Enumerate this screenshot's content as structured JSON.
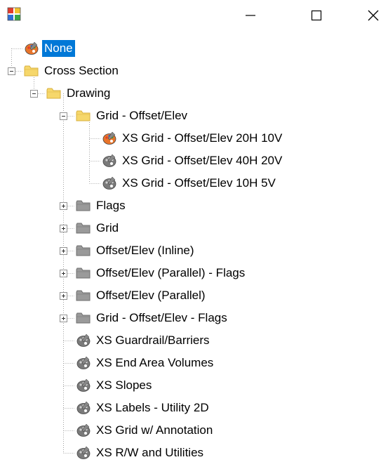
{
  "window": {
    "controls": {
      "minimize": "minimize-icon",
      "maximize": "maximize-icon",
      "close": "close-icon"
    }
  },
  "colors": {
    "selection": "#0078d7",
    "folder_open": "#f6d76b",
    "folder_closed": "#9a9a9a",
    "palette_active": "#e8742a",
    "palette_inactive": "#7a7a7a"
  },
  "tree": {
    "nodes": [
      {
        "label": "None",
        "selected": true,
        "icon": "palette-color-icon",
        "expander": null
      },
      {
        "label": "Cross Section",
        "icon": "folder-open-icon",
        "expander": "collapse"
      },
      {
        "label": "Drawing",
        "icon": "folder-open-icon",
        "expander": "collapse"
      },
      {
        "label": "Grid - Offset/Elev",
        "icon": "folder-open-icon",
        "expander": "collapse"
      },
      {
        "label": "XS Grid - Offset/Elev 20H 10V",
        "icon": "palette-color-icon",
        "expander": null
      },
      {
        "label": "XS Grid - Offset/Elev 40H 20V",
        "icon": "palette-gray-icon",
        "expander": null
      },
      {
        "label": "XS Grid - Offset/Elev 10H 5V",
        "icon": "palette-gray-icon",
        "expander": null
      },
      {
        "label": "Flags",
        "icon": "folder-closed-icon",
        "expander": "expand"
      },
      {
        "label": "Grid",
        "icon": "folder-closed-icon",
        "expander": "expand"
      },
      {
        "label": "Offset/Elev (Inline)",
        "icon": "folder-closed-icon",
        "expander": "expand"
      },
      {
        "label": "Offset/Elev (Parallel) - Flags",
        "icon": "folder-closed-icon",
        "expander": "expand"
      },
      {
        "label": "Offset/Elev (Parallel)",
        "icon": "folder-closed-icon",
        "expander": "expand"
      },
      {
        "label": "Grid - Offset/Elev - Flags",
        "icon": "folder-closed-icon",
        "expander": "expand"
      },
      {
        "label": "XS Guardrail/Barriers",
        "icon": "palette-gray-icon",
        "expander": null
      },
      {
        "label": "XS End Area Volumes",
        "icon": "palette-gray-icon",
        "expander": null
      },
      {
        "label": "XS Slopes",
        "icon": "palette-gray-icon",
        "expander": null
      },
      {
        "label": "XS Labels - Utility 2D",
        "icon": "palette-gray-icon",
        "expander": null
      },
      {
        "label": "XS Grid w/ Annotation",
        "icon": "palette-gray-icon",
        "expander": null
      },
      {
        "label": "XS R/W and Utilities",
        "icon": "palette-gray-icon",
        "expander": null
      }
    ]
  }
}
